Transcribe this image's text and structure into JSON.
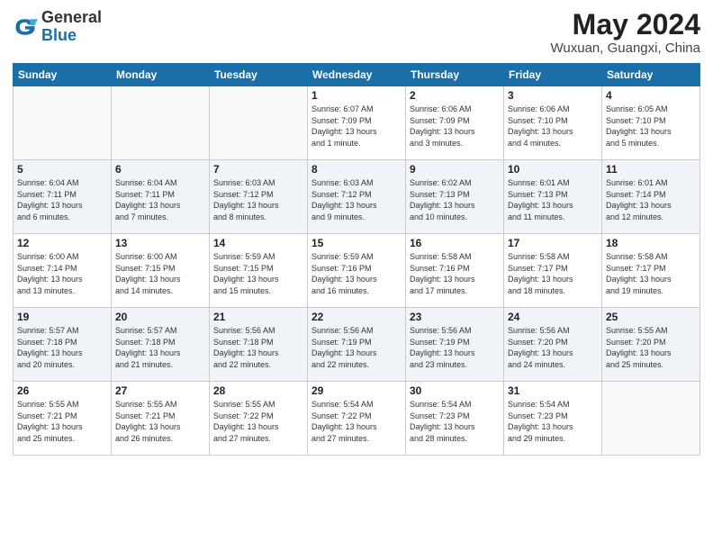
{
  "header": {
    "logo_general": "General",
    "logo_blue": "Blue",
    "month": "May 2024",
    "location": "Wuxuan, Guangxi, China"
  },
  "weekdays": [
    "Sunday",
    "Monday",
    "Tuesday",
    "Wednesday",
    "Thursday",
    "Friday",
    "Saturday"
  ],
  "weeks": [
    [
      {
        "day": "",
        "info": ""
      },
      {
        "day": "",
        "info": ""
      },
      {
        "day": "",
        "info": ""
      },
      {
        "day": "1",
        "info": "Sunrise: 6:07 AM\nSunset: 7:09 PM\nDaylight: 13 hours\nand 1 minute."
      },
      {
        "day": "2",
        "info": "Sunrise: 6:06 AM\nSunset: 7:09 PM\nDaylight: 13 hours\nand 3 minutes."
      },
      {
        "day": "3",
        "info": "Sunrise: 6:06 AM\nSunset: 7:10 PM\nDaylight: 13 hours\nand 4 minutes."
      },
      {
        "day": "4",
        "info": "Sunrise: 6:05 AM\nSunset: 7:10 PM\nDaylight: 13 hours\nand 5 minutes."
      }
    ],
    [
      {
        "day": "5",
        "info": "Sunrise: 6:04 AM\nSunset: 7:11 PM\nDaylight: 13 hours\nand 6 minutes."
      },
      {
        "day": "6",
        "info": "Sunrise: 6:04 AM\nSunset: 7:11 PM\nDaylight: 13 hours\nand 7 minutes."
      },
      {
        "day": "7",
        "info": "Sunrise: 6:03 AM\nSunset: 7:12 PM\nDaylight: 13 hours\nand 8 minutes."
      },
      {
        "day": "8",
        "info": "Sunrise: 6:03 AM\nSunset: 7:12 PM\nDaylight: 13 hours\nand 9 minutes."
      },
      {
        "day": "9",
        "info": "Sunrise: 6:02 AM\nSunset: 7:13 PM\nDaylight: 13 hours\nand 10 minutes."
      },
      {
        "day": "10",
        "info": "Sunrise: 6:01 AM\nSunset: 7:13 PM\nDaylight: 13 hours\nand 11 minutes."
      },
      {
        "day": "11",
        "info": "Sunrise: 6:01 AM\nSunset: 7:14 PM\nDaylight: 13 hours\nand 12 minutes."
      }
    ],
    [
      {
        "day": "12",
        "info": "Sunrise: 6:00 AM\nSunset: 7:14 PM\nDaylight: 13 hours\nand 13 minutes."
      },
      {
        "day": "13",
        "info": "Sunrise: 6:00 AM\nSunset: 7:15 PM\nDaylight: 13 hours\nand 14 minutes."
      },
      {
        "day": "14",
        "info": "Sunrise: 5:59 AM\nSunset: 7:15 PM\nDaylight: 13 hours\nand 15 minutes."
      },
      {
        "day": "15",
        "info": "Sunrise: 5:59 AM\nSunset: 7:16 PM\nDaylight: 13 hours\nand 16 minutes."
      },
      {
        "day": "16",
        "info": "Sunrise: 5:58 AM\nSunset: 7:16 PM\nDaylight: 13 hours\nand 17 minutes."
      },
      {
        "day": "17",
        "info": "Sunrise: 5:58 AM\nSunset: 7:17 PM\nDaylight: 13 hours\nand 18 minutes."
      },
      {
        "day": "18",
        "info": "Sunrise: 5:58 AM\nSunset: 7:17 PM\nDaylight: 13 hours\nand 19 minutes."
      }
    ],
    [
      {
        "day": "19",
        "info": "Sunrise: 5:57 AM\nSunset: 7:18 PM\nDaylight: 13 hours\nand 20 minutes."
      },
      {
        "day": "20",
        "info": "Sunrise: 5:57 AM\nSunset: 7:18 PM\nDaylight: 13 hours\nand 21 minutes."
      },
      {
        "day": "21",
        "info": "Sunrise: 5:56 AM\nSunset: 7:18 PM\nDaylight: 13 hours\nand 22 minutes."
      },
      {
        "day": "22",
        "info": "Sunrise: 5:56 AM\nSunset: 7:19 PM\nDaylight: 13 hours\nand 22 minutes."
      },
      {
        "day": "23",
        "info": "Sunrise: 5:56 AM\nSunset: 7:19 PM\nDaylight: 13 hours\nand 23 minutes."
      },
      {
        "day": "24",
        "info": "Sunrise: 5:56 AM\nSunset: 7:20 PM\nDaylight: 13 hours\nand 24 minutes."
      },
      {
        "day": "25",
        "info": "Sunrise: 5:55 AM\nSunset: 7:20 PM\nDaylight: 13 hours\nand 25 minutes."
      }
    ],
    [
      {
        "day": "26",
        "info": "Sunrise: 5:55 AM\nSunset: 7:21 PM\nDaylight: 13 hours\nand 25 minutes."
      },
      {
        "day": "27",
        "info": "Sunrise: 5:55 AM\nSunset: 7:21 PM\nDaylight: 13 hours\nand 26 minutes."
      },
      {
        "day": "28",
        "info": "Sunrise: 5:55 AM\nSunset: 7:22 PM\nDaylight: 13 hours\nand 27 minutes."
      },
      {
        "day": "29",
        "info": "Sunrise: 5:54 AM\nSunset: 7:22 PM\nDaylight: 13 hours\nand 27 minutes."
      },
      {
        "day": "30",
        "info": "Sunrise: 5:54 AM\nSunset: 7:23 PM\nDaylight: 13 hours\nand 28 minutes."
      },
      {
        "day": "31",
        "info": "Sunrise: 5:54 AM\nSunset: 7:23 PM\nDaylight: 13 hours\nand 29 minutes."
      },
      {
        "day": "",
        "info": ""
      }
    ]
  ]
}
